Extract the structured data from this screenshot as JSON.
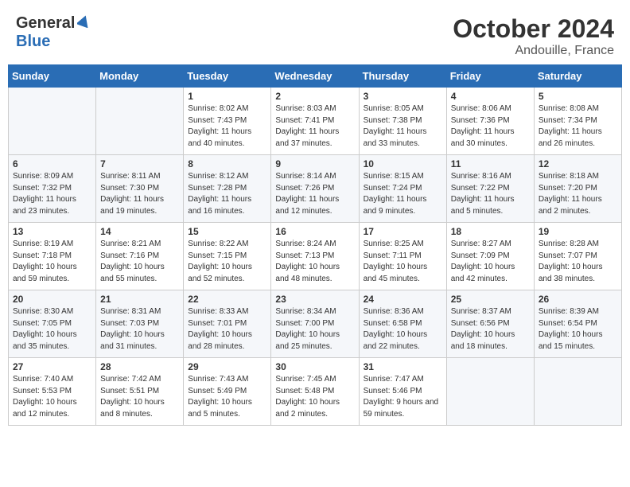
{
  "header": {
    "logo_general": "General",
    "logo_blue": "Blue",
    "month": "October 2024",
    "location": "Andouille, France"
  },
  "days_of_week": [
    "Sunday",
    "Monday",
    "Tuesday",
    "Wednesday",
    "Thursday",
    "Friday",
    "Saturday"
  ],
  "weeks": [
    [
      {
        "day": "",
        "info": ""
      },
      {
        "day": "",
        "info": ""
      },
      {
        "day": "1",
        "info": "Sunrise: 8:02 AM\nSunset: 7:43 PM\nDaylight: 11 hours and 40 minutes."
      },
      {
        "day": "2",
        "info": "Sunrise: 8:03 AM\nSunset: 7:41 PM\nDaylight: 11 hours and 37 minutes."
      },
      {
        "day": "3",
        "info": "Sunrise: 8:05 AM\nSunset: 7:38 PM\nDaylight: 11 hours and 33 minutes."
      },
      {
        "day": "4",
        "info": "Sunrise: 8:06 AM\nSunset: 7:36 PM\nDaylight: 11 hours and 30 minutes."
      },
      {
        "day": "5",
        "info": "Sunrise: 8:08 AM\nSunset: 7:34 PM\nDaylight: 11 hours and 26 minutes."
      }
    ],
    [
      {
        "day": "6",
        "info": "Sunrise: 8:09 AM\nSunset: 7:32 PM\nDaylight: 11 hours and 23 minutes."
      },
      {
        "day": "7",
        "info": "Sunrise: 8:11 AM\nSunset: 7:30 PM\nDaylight: 11 hours and 19 minutes."
      },
      {
        "day": "8",
        "info": "Sunrise: 8:12 AM\nSunset: 7:28 PM\nDaylight: 11 hours and 16 minutes."
      },
      {
        "day": "9",
        "info": "Sunrise: 8:14 AM\nSunset: 7:26 PM\nDaylight: 11 hours and 12 minutes."
      },
      {
        "day": "10",
        "info": "Sunrise: 8:15 AM\nSunset: 7:24 PM\nDaylight: 11 hours and 9 minutes."
      },
      {
        "day": "11",
        "info": "Sunrise: 8:16 AM\nSunset: 7:22 PM\nDaylight: 11 hours and 5 minutes."
      },
      {
        "day": "12",
        "info": "Sunrise: 8:18 AM\nSunset: 7:20 PM\nDaylight: 11 hours and 2 minutes."
      }
    ],
    [
      {
        "day": "13",
        "info": "Sunrise: 8:19 AM\nSunset: 7:18 PM\nDaylight: 10 hours and 59 minutes."
      },
      {
        "day": "14",
        "info": "Sunrise: 8:21 AM\nSunset: 7:16 PM\nDaylight: 10 hours and 55 minutes."
      },
      {
        "day": "15",
        "info": "Sunrise: 8:22 AM\nSunset: 7:15 PM\nDaylight: 10 hours and 52 minutes."
      },
      {
        "day": "16",
        "info": "Sunrise: 8:24 AM\nSunset: 7:13 PM\nDaylight: 10 hours and 48 minutes."
      },
      {
        "day": "17",
        "info": "Sunrise: 8:25 AM\nSunset: 7:11 PM\nDaylight: 10 hours and 45 minutes."
      },
      {
        "day": "18",
        "info": "Sunrise: 8:27 AM\nSunset: 7:09 PM\nDaylight: 10 hours and 42 minutes."
      },
      {
        "day": "19",
        "info": "Sunrise: 8:28 AM\nSunset: 7:07 PM\nDaylight: 10 hours and 38 minutes."
      }
    ],
    [
      {
        "day": "20",
        "info": "Sunrise: 8:30 AM\nSunset: 7:05 PM\nDaylight: 10 hours and 35 minutes."
      },
      {
        "day": "21",
        "info": "Sunrise: 8:31 AM\nSunset: 7:03 PM\nDaylight: 10 hours and 31 minutes."
      },
      {
        "day": "22",
        "info": "Sunrise: 8:33 AM\nSunset: 7:01 PM\nDaylight: 10 hours and 28 minutes."
      },
      {
        "day": "23",
        "info": "Sunrise: 8:34 AM\nSunset: 7:00 PM\nDaylight: 10 hours and 25 minutes."
      },
      {
        "day": "24",
        "info": "Sunrise: 8:36 AM\nSunset: 6:58 PM\nDaylight: 10 hours and 22 minutes."
      },
      {
        "day": "25",
        "info": "Sunrise: 8:37 AM\nSunset: 6:56 PM\nDaylight: 10 hours and 18 minutes."
      },
      {
        "day": "26",
        "info": "Sunrise: 8:39 AM\nSunset: 6:54 PM\nDaylight: 10 hours and 15 minutes."
      }
    ],
    [
      {
        "day": "27",
        "info": "Sunrise: 7:40 AM\nSunset: 5:53 PM\nDaylight: 10 hours and 12 minutes."
      },
      {
        "day": "28",
        "info": "Sunrise: 7:42 AM\nSunset: 5:51 PM\nDaylight: 10 hours and 8 minutes."
      },
      {
        "day": "29",
        "info": "Sunrise: 7:43 AM\nSunset: 5:49 PM\nDaylight: 10 hours and 5 minutes."
      },
      {
        "day": "30",
        "info": "Sunrise: 7:45 AM\nSunset: 5:48 PM\nDaylight: 10 hours and 2 minutes."
      },
      {
        "day": "31",
        "info": "Sunrise: 7:47 AM\nSunset: 5:46 PM\nDaylight: 9 hours and 59 minutes."
      },
      {
        "day": "",
        "info": ""
      },
      {
        "day": "",
        "info": ""
      }
    ]
  ]
}
